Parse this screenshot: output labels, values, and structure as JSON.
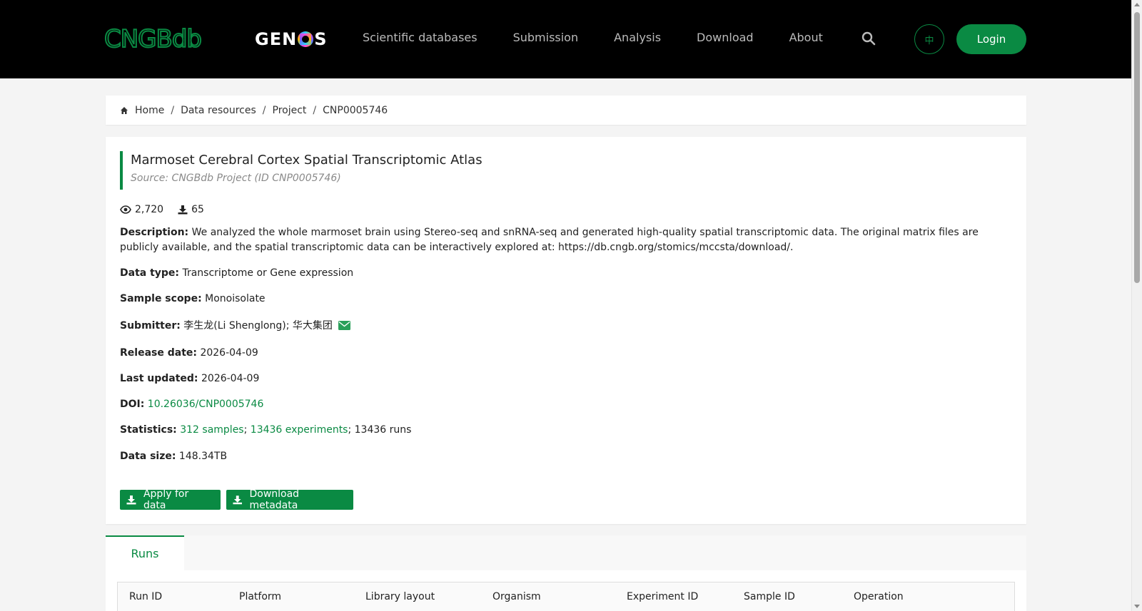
{
  "header": {
    "logo_text": "CNGBdb",
    "genos_logo_text": "GENOS",
    "nav": [
      "Scientific databases",
      "Submission",
      "Analysis",
      "Download",
      "About"
    ],
    "lang_label": "中",
    "login_label": "Login",
    "icons": {
      "search": "search-icon"
    }
  },
  "breadcrumb": [
    "Home",
    "Data resources",
    "Project",
    "CNP0005746"
  ],
  "project": {
    "title": "Marmoset Cerebral Cortex Spatial Transcriptomic Atlas",
    "source": "Source: CNGBdb Project (ID CNP0005746)",
    "views": "2,720",
    "downloads": "65",
    "description_label": "Description:",
    "description": "We analyzed the whole marmoset brain using Stereo-seq and snRNA-seq and generated high-quality spatial transcriptomic data. The original matrix files are publicly available, and the spatial transcriptomic data can be interactively explored at: https://db.cngb.org/stomics/mccsta/download/.",
    "data_type_label": "Data type:",
    "data_type": "Transcriptome or Gene expression",
    "sample_scope_label": "Sample scope:",
    "sample_scope": "Monoisolate",
    "submitter_label": "Submitter:",
    "submitter": "李生龙(Li Shenglong); 华大集团",
    "release_date_label": "Release date:",
    "release_date": "2026-04-09",
    "last_updated_label": "Last updated:",
    "last_updated": "2026-04-09",
    "doi_label": "DOI:",
    "doi": "10.26036/CNP0005746",
    "statistics_label": "Statistics:",
    "stat_samples": "312 samples",
    "stat_sep1": "; ",
    "stat_experiments": "13436 experiments",
    "stat_runs": "; 13436 runs",
    "data_size_label": "Data size:",
    "data_size": "148.34TB",
    "apply_label": "Apply for data",
    "download_meta_label": "Download metadata"
  },
  "tabs": [
    {
      "label": "Runs",
      "active": true
    }
  ],
  "table": {
    "columns": [
      "Run ID",
      "Platform",
      "Library layout",
      "Organism",
      "Experiment ID",
      "Sample ID",
      "Operation"
    ]
  },
  "colors": {
    "accent": "#0a8a43",
    "header_bg": "#000000"
  }
}
